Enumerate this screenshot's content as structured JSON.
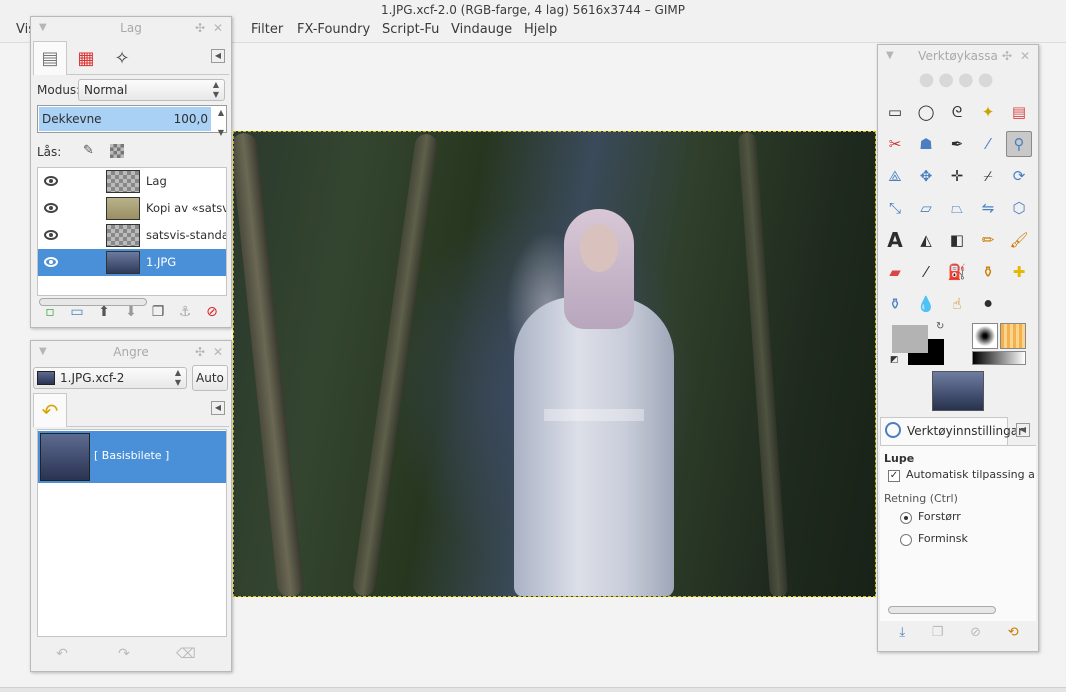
{
  "window": {
    "title": "1.JPG.xcf-2.0 (RGB-farge, 4 lag) 5616x3744 – GIMP"
  },
  "menu": [
    "Vis",
    "Filter",
    "FX-Foundry",
    "Script-Fu",
    "Vindauge",
    "Hjelp"
  ],
  "layers_panel": {
    "title": "Lag",
    "mode_label": "Modus:",
    "mode_value": "Normal",
    "opacity_label": "Dekkevne",
    "opacity_value": "100,0",
    "opacity_fraction": 1.0,
    "lock_label": "Lås:",
    "layers": [
      {
        "name": "Lag",
        "visible": true,
        "selected": false
      },
      {
        "name": "Kopi av «satsvis-",
        "visible": true,
        "selected": false
      },
      {
        "name": "satsvis-standardc",
        "visible": true,
        "selected": false
      },
      {
        "name": "1.JPG",
        "visible": true,
        "selected": true
      }
    ],
    "buttons": [
      "new-layer-icon",
      "new-group-icon",
      "raise-icon",
      "lower-icon",
      "duplicate-icon",
      "anchor-icon",
      "delete-icon"
    ]
  },
  "undo_panel": {
    "title": "Angre",
    "image_select": "1.JPG.xcf-2",
    "auto_label": "Auto",
    "history": [
      {
        "label": "[ Basisbilete ]",
        "selected": true
      }
    ]
  },
  "toolbox": {
    "title": "Verktøykassa",
    "options_tab": "Verktøyinnstillingar",
    "tool_name": "Lupe",
    "auto_resize_label": "Automatisk tilpassing av v",
    "auto_resize_checked": true,
    "direction_label": "Retning (Ctrl)",
    "zoom_in_label": "Forstørr",
    "zoom_out_label": "Forminsk",
    "zoom_in_selected": true,
    "colors": {
      "foreground": "#b3b3b3",
      "background": "#000000",
      "selection": "#4a90d9"
    }
  }
}
